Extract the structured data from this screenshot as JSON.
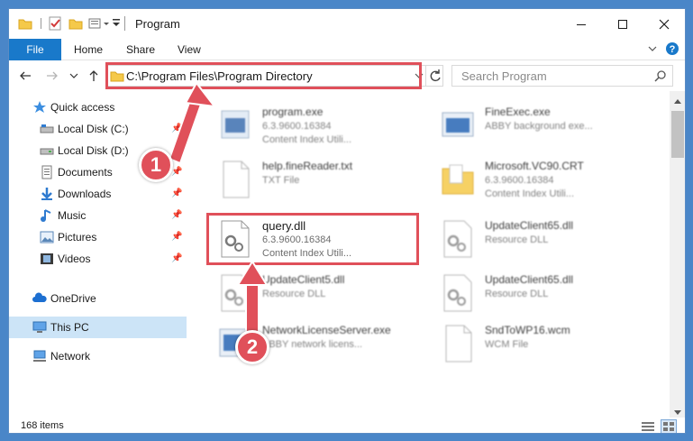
{
  "window": {
    "title": "Program"
  },
  "ribbon": {
    "tabs": [
      {
        "label": "File"
      },
      {
        "label": "Home"
      },
      {
        "label": "Share"
      },
      {
        "label": "View"
      }
    ]
  },
  "address": {
    "path": "C:\\Program Files\\Program Directory"
  },
  "search": {
    "placeholder": "Search Program"
  },
  "sidebar": {
    "items": [
      {
        "label": "Quick access",
        "icon": "star-icon"
      },
      {
        "label": "Local Disk (C:)",
        "icon": "drive-icon"
      },
      {
        "label": "Local Disk (D:)",
        "icon": "drive-icon"
      },
      {
        "label": "Documents",
        "icon": "documents-icon"
      },
      {
        "label": "Downloads",
        "icon": "download-icon"
      },
      {
        "label": "Music",
        "icon": "music-icon"
      },
      {
        "label": "Pictures",
        "icon": "pictures-icon"
      },
      {
        "label": "Videos",
        "icon": "videos-icon"
      },
      {
        "label": "OneDrive",
        "icon": "cloud-icon"
      },
      {
        "label": "This PC",
        "icon": "computer-icon"
      },
      {
        "label": "Network",
        "icon": "network-icon"
      }
    ]
  },
  "files": [
    {
      "name": "program.exe",
      "line2": "6.3.9600.16384",
      "line3": "Content Index Utili...",
      "icon": "exe-icon"
    },
    {
      "name": "FineExec.exe",
      "line2": "ABBY background exe...",
      "line3": "",
      "icon": "exe-icon"
    },
    {
      "name": "help.fineReader.txt",
      "line2": "TXT File",
      "line3": "",
      "icon": "text-file-icon"
    },
    {
      "name": "Microsoft.VC90.CRT",
      "line2": "6.3.9600.16384",
      "line3": "Content Index Utili...",
      "icon": "folder-icon"
    },
    {
      "name": "query.dll",
      "line2": "6.3.9600.16384",
      "line3": "Content Index Utili...",
      "icon": "dll-icon"
    },
    {
      "name": "UpdateClient65.dll",
      "line2": "Resource DLL",
      "line3": "",
      "icon": "dll-icon"
    },
    {
      "name": "UpdateClient5.dll",
      "line2": "Resource DLL",
      "line3": "",
      "icon": "dll-icon"
    },
    {
      "name": "UpdateClient65.dll",
      "line2": "Resource DLL",
      "line3": "",
      "icon": "dll-icon"
    },
    {
      "name": "NetworkLicenseServer.exe",
      "line2": "ABBY network licens...",
      "line3": "",
      "icon": "exe-icon"
    },
    {
      "name": "SndToWP16.wcm",
      "line2": "WCM File",
      "line3": "",
      "icon": "text-file-icon"
    }
  ],
  "status": {
    "items": "168 items"
  },
  "annotations": {
    "step1": "1",
    "step2": "2"
  },
  "colors": {
    "accent": "#1979ca",
    "highlight": "#e0505a",
    "selected": "#cce4f7"
  }
}
